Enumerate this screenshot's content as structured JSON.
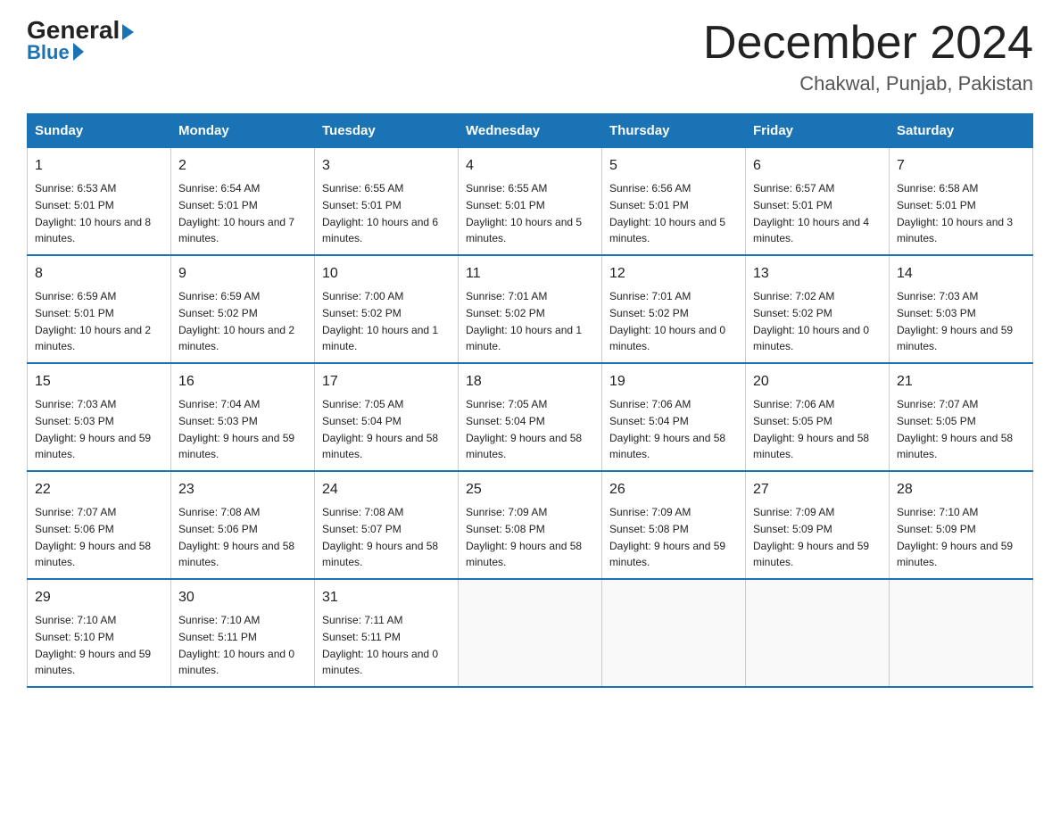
{
  "header": {
    "logo_general": "General",
    "logo_blue": "Blue",
    "month_title": "December 2024",
    "location": "Chakwal, Punjab, Pakistan"
  },
  "weekdays": [
    "Sunday",
    "Monday",
    "Tuesday",
    "Wednesday",
    "Thursday",
    "Friday",
    "Saturday"
  ],
  "weeks": [
    [
      {
        "day": "1",
        "sunrise": "6:53 AM",
        "sunset": "5:01 PM",
        "daylight": "10 hours and 8 minutes."
      },
      {
        "day": "2",
        "sunrise": "6:54 AM",
        "sunset": "5:01 PM",
        "daylight": "10 hours and 7 minutes."
      },
      {
        "day": "3",
        "sunrise": "6:55 AM",
        "sunset": "5:01 PM",
        "daylight": "10 hours and 6 minutes."
      },
      {
        "day": "4",
        "sunrise": "6:55 AM",
        "sunset": "5:01 PM",
        "daylight": "10 hours and 5 minutes."
      },
      {
        "day": "5",
        "sunrise": "6:56 AM",
        "sunset": "5:01 PM",
        "daylight": "10 hours and 5 minutes."
      },
      {
        "day": "6",
        "sunrise": "6:57 AM",
        "sunset": "5:01 PM",
        "daylight": "10 hours and 4 minutes."
      },
      {
        "day": "7",
        "sunrise": "6:58 AM",
        "sunset": "5:01 PM",
        "daylight": "10 hours and 3 minutes."
      }
    ],
    [
      {
        "day": "8",
        "sunrise": "6:59 AM",
        "sunset": "5:01 PM",
        "daylight": "10 hours and 2 minutes."
      },
      {
        "day": "9",
        "sunrise": "6:59 AM",
        "sunset": "5:02 PM",
        "daylight": "10 hours and 2 minutes."
      },
      {
        "day": "10",
        "sunrise": "7:00 AM",
        "sunset": "5:02 PM",
        "daylight": "10 hours and 1 minute."
      },
      {
        "day": "11",
        "sunrise": "7:01 AM",
        "sunset": "5:02 PM",
        "daylight": "10 hours and 1 minute."
      },
      {
        "day": "12",
        "sunrise": "7:01 AM",
        "sunset": "5:02 PM",
        "daylight": "10 hours and 0 minutes."
      },
      {
        "day": "13",
        "sunrise": "7:02 AM",
        "sunset": "5:02 PM",
        "daylight": "10 hours and 0 minutes."
      },
      {
        "day": "14",
        "sunrise": "7:03 AM",
        "sunset": "5:03 PM",
        "daylight": "9 hours and 59 minutes."
      }
    ],
    [
      {
        "day": "15",
        "sunrise": "7:03 AM",
        "sunset": "5:03 PM",
        "daylight": "9 hours and 59 minutes."
      },
      {
        "day": "16",
        "sunrise": "7:04 AM",
        "sunset": "5:03 PM",
        "daylight": "9 hours and 59 minutes."
      },
      {
        "day": "17",
        "sunrise": "7:05 AM",
        "sunset": "5:04 PM",
        "daylight": "9 hours and 58 minutes."
      },
      {
        "day": "18",
        "sunrise": "7:05 AM",
        "sunset": "5:04 PM",
        "daylight": "9 hours and 58 minutes."
      },
      {
        "day": "19",
        "sunrise": "7:06 AM",
        "sunset": "5:04 PM",
        "daylight": "9 hours and 58 minutes."
      },
      {
        "day": "20",
        "sunrise": "7:06 AM",
        "sunset": "5:05 PM",
        "daylight": "9 hours and 58 minutes."
      },
      {
        "day": "21",
        "sunrise": "7:07 AM",
        "sunset": "5:05 PM",
        "daylight": "9 hours and 58 minutes."
      }
    ],
    [
      {
        "day": "22",
        "sunrise": "7:07 AM",
        "sunset": "5:06 PM",
        "daylight": "9 hours and 58 minutes."
      },
      {
        "day": "23",
        "sunrise": "7:08 AM",
        "sunset": "5:06 PM",
        "daylight": "9 hours and 58 minutes."
      },
      {
        "day": "24",
        "sunrise": "7:08 AM",
        "sunset": "5:07 PM",
        "daylight": "9 hours and 58 minutes."
      },
      {
        "day": "25",
        "sunrise": "7:09 AM",
        "sunset": "5:08 PM",
        "daylight": "9 hours and 58 minutes."
      },
      {
        "day": "26",
        "sunrise": "7:09 AM",
        "sunset": "5:08 PM",
        "daylight": "9 hours and 59 minutes."
      },
      {
        "day": "27",
        "sunrise": "7:09 AM",
        "sunset": "5:09 PM",
        "daylight": "9 hours and 59 minutes."
      },
      {
        "day": "28",
        "sunrise": "7:10 AM",
        "sunset": "5:09 PM",
        "daylight": "9 hours and 59 minutes."
      }
    ],
    [
      {
        "day": "29",
        "sunrise": "7:10 AM",
        "sunset": "5:10 PM",
        "daylight": "9 hours and 59 minutes."
      },
      {
        "day": "30",
        "sunrise": "7:10 AM",
        "sunset": "5:11 PM",
        "daylight": "10 hours and 0 minutes."
      },
      {
        "day": "31",
        "sunrise": "7:11 AM",
        "sunset": "5:11 PM",
        "daylight": "10 hours and 0 minutes."
      },
      null,
      null,
      null,
      null
    ]
  ],
  "labels": {
    "sunrise": "Sunrise:",
    "sunset": "Sunset:",
    "daylight": "Daylight:"
  }
}
